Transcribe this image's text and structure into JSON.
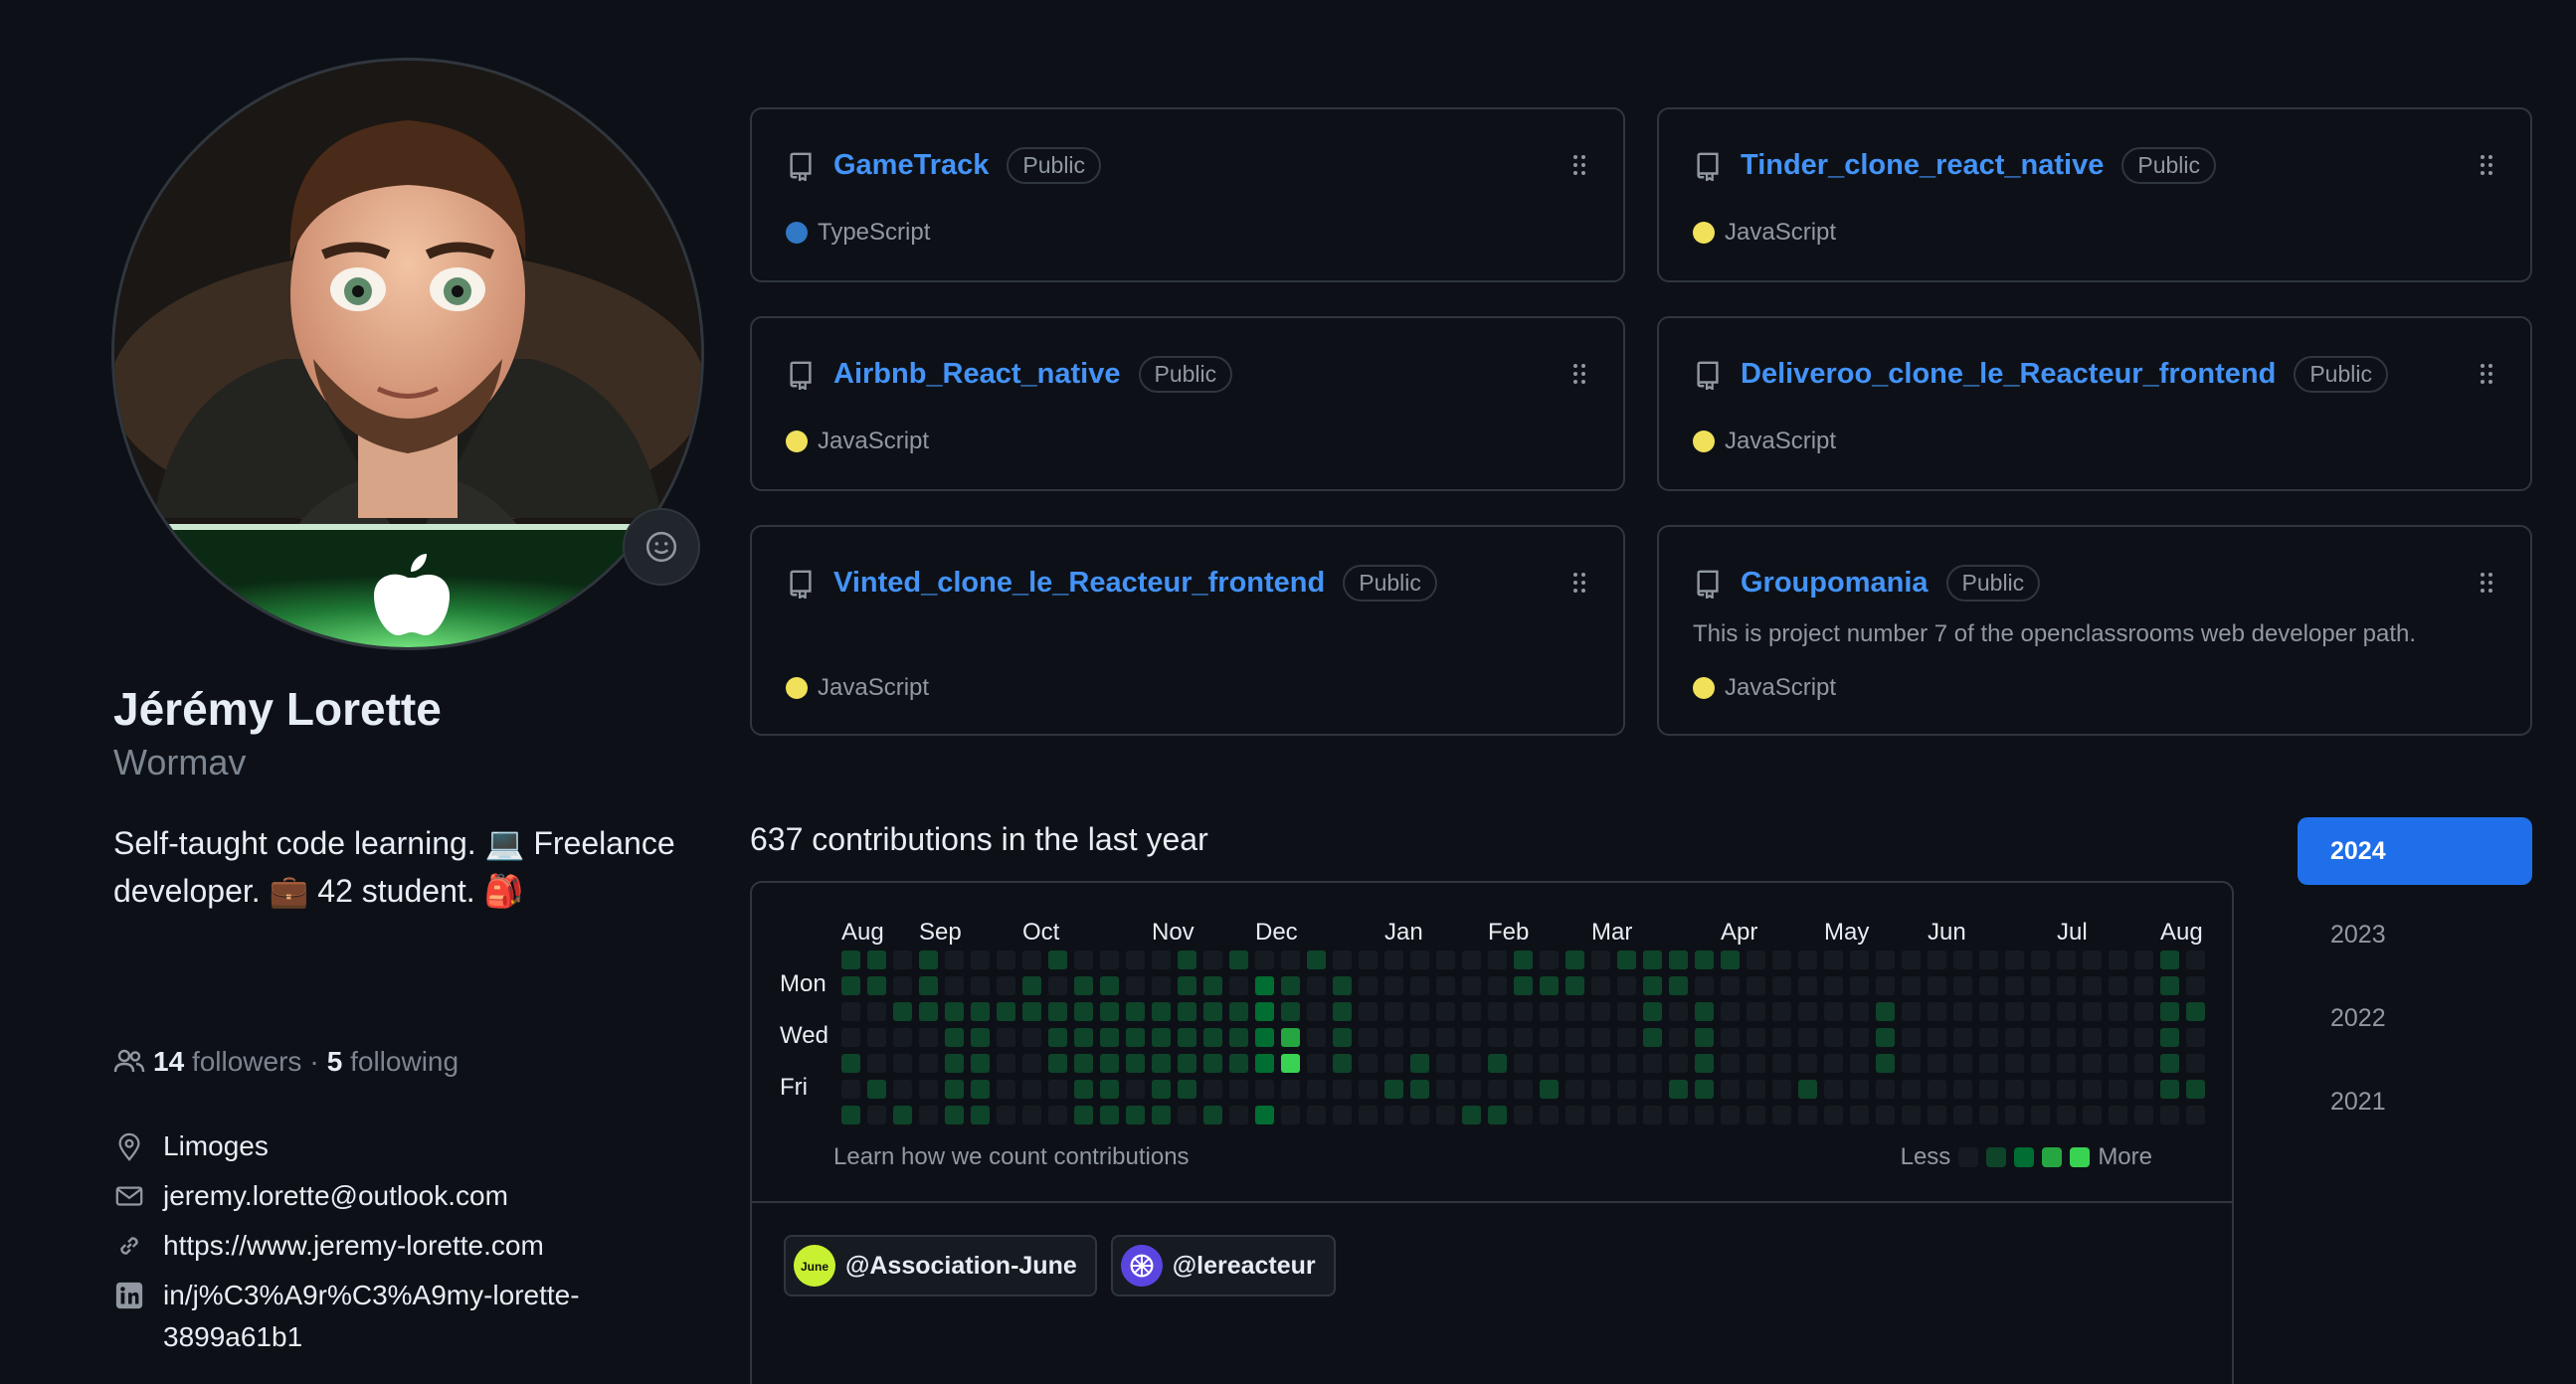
{
  "profile": {
    "fullname": "Jérémy Lorette",
    "username": "Wormav",
    "bio_line1": "Self-taught code learning. 💻 Freelance",
    "bio_line2": "developer. 💼 42 student. 🎒",
    "followers_count": "14",
    "followers_label": "followers",
    "separator": "·",
    "following_count": "5",
    "following_label": "following",
    "location": "Limoges",
    "email": "jeremy.lorette@outlook.com",
    "website": "https://www.jeremy-lorette.com",
    "linkedin_line1": "in/j%C3%A9r%C3%A9my-lorette-",
    "linkedin_line2": "3899a61b1"
  },
  "repos": [
    {
      "name": "GameTrack",
      "visibility": "Public",
      "description": "",
      "language": "TypeScript",
      "language_color": "#3178c6"
    },
    {
      "name": "Tinder_clone_react_native",
      "visibility": "Public",
      "description": "",
      "language": "JavaScript",
      "language_color": "#f1e05a"
    },
    {
      "name": "Airbnb_React_native",
      "visibility": "Public",
      "description": "",
      "language": "JavaScript",
      "language_color": "#f1e05a"
    },
    {
      "name": "Deliveroo_clone_le_Reacteur_frontend",
      "visibility": "Public",
      "description": "",
      "language": "JavaScript",
      "language_color": "#f1e05a"
    },
    {
      "name": "Vinted_clone_le_Reacteur_frontend",
      "visibility": "Public",
      "description": "",
      "language": "JavaScript",
      "language_color": "#f1e05a"
    },
    {
      "name": "Groupomania",
      "visibility": "Public",
      "description": "This is project number 7 of the openclassrooms web developer path.",
      "language": "JavaScript",
      "language_color": "#f1e05a"
    }
  ],
  "contributions": {
    "title": "637 contributions in the last year",
    "months": [
      "Aug",
      "Sep",
      "Oct",
      "Nov",
      "Dec",
      "Jan",
      "Feb",
      "Mar",
      "Apr",
      "May",
      "Jun",
      "Jul",
      "Aug"
    ],
    "days": [
      "Mon",
      "Wed",
      "Fri"
    ],
    "learn_link": "Learn how we count contributions",
    "legend_less": "Less",
    "legend_more": "More",
    "levels": [
      "#161b22",
      "#0e4429",
      "#006d32",
      "#26a641",
      "#39d353"
    ],
    "weeks": [
      [
        1,
        1,
        0,
        0,
        1,
        0,
        1
      ],
      [
        1,
        1,
        0,
        0,
        0,
        1,
        0
      ],
      [
        0,
        0,
        1,
        0,
        0,
        0,
        1
      ],
      [
        1,
        1,
        1,
        0,
        0,
        0,
        0
      ],
      [
        0,
        0,
        1,
        1,
        1,
        1,
        1
      ],
      [
        0,
        0,
        1,
        1,
        1,
        1,
        1
      ],
      [
        0,
        0,
        1,
        0,
        0,
        0,
        0
      ],
      [
        0,
        1,
        1,
        0,
        0,
        0,
        0
      ],
      [
        1,
        0,
        1,
        1,
        1,
        0,
        0
      ],
      [
        0,
        1,
        1,
        1,
        1,
        1,
        1
      ],
      [
        0,
        1,
        1,
        1,
        1,
        1,
        1
      ],
      [
        0,
        0,
        1,
        1,
        1,
        0,
        1
      ],
      [
        0,
        0,
        1,
        1,
        1,
        1,
        1
      ],
      [
        1,
        1,
        1,
        1,
        1,
        1,
        0
      ],
      [
        0,
        1,
        1,
        1,
        1,
        0,
        1
      ],
      [
        1,
        0,
        1,
        1,
        1,
        0,
        0
      ],
      [
        0,
        2,
        2,
        2,
        2,
        0,
        2
      ],
      [
        0,
        1,
        1,
        3,
        4,
        0,
        0
      ],
      [
        1,
        0,
        0,
        0,
        0,
        0,
        0
      ],
      [
        0,
        1,
        1,
        1,
        1,
        0,
        0
      ],
      [
        0,
        0,
        0,
        0,
        0,
        0,
        0
      ],
      [
        0,
        0,
        0,
        0,
        0,
        1,
        0
      ],
      [
        0,
        0,
        0,
        0,
        1,
        1,
        0
      ],
      [
        0,
        0,
        0,
        0,
        0,
        0,
        0
      ],
      [
        0,
        0,
        0,
        0,
        0,
        0,
        1
      ],
      [
        0,
        0,
        0,
        0,
        1,
        0,
        1
      ],
      [
        1,
        1,
        0,
        0,
        0,
        0,
        0
      ],
      [
        0,
        1,
        0,
        0,
        0,
        1,
        0
      ],
      [
        1,
        1,
        0,
        0,
        0,
        0,
        0
      ],
      [
        0,
        0,
        0,
        0,
        0,
        0,
        0
      ],
      [
        1,
        0,
        0,
        0,
        0,
        0,
        0
      ],
      [
        1,
        1,
        1,
        1,
        0,
        0,
        0
      ],
      [
        1,
        1,
        0,
        0,
        0,
        1,
        0
      ],
      [
        1,
        0,
        1,
        1,
        1,
        1,
        0
      ],
      [
        1,
        0,
        0,
        0,
        0,
        0,
        0
      ],
      [
        0,
        0,
        0,
        0,
        0,
        0,
        0
      ],
      [
        0,
        0,
        0,
        0,
        0,
        0,
        0
      ],
      [
        0,
        0,
        0,
        0,
        0,
        1,
        0
      ],
      [
        0,
        0,
        0,
        0,
        0,
        0,
        0
      ],
      [
        0,
        0,
        0,
        0,
        0,
        0,
        0
      ],
      [
        0,
        0,
        1,
        1,
        1,
        0,
        0
      ],
      [
        0,
        0,
        0,
        0,
        0,
        0,
        0
      ],
      [
        0,
        0,
        0,
        0,
        0,
        0,
        0
      ],
      [
        0,
        0,
        0,
        0,
        0,
        0,
        0
      ],
      [
        0,
        0,
        0,
        0,
        0,
        0,
        0
      ],
      [
        0,
        0,
        0,
        0,
        0,
        0,
        0
      ],
      [
        0,
        0,
        0,
        0,
        0,
        0,
        0
      ],
      [
        0,
        0,
        0,
        0,
        0,
        0,
        0
      ],
      [
        0,
        0,
        0,
        0,
        0,
        0,
        0
      ],
      [
        0,
        0,
        0,
        0,
        0,
        0,
        0
      ],
      [
        0,
        0,
        0,
        0,
        0,
        0,
        0
      ],
      [
        1,
        1,
        1,
        1,
        1,
        1,
        0
      ],
      [
        0,
        0,
        1,
        0,
        0,
        1,
        0
      ]
    ]
  },
  "organizations": [
    {
      "handle": "@Association-June",
      "avatar_color": "#c8f231"
    },
    {
      "handle": "@lereacteur",
      "avatar_color": "#5b45e0"
    }
  ],
  "years": [
    "2024",
    "2023",
    "2022",
    "2021"
  ],
  "active_year": "2024"
}
